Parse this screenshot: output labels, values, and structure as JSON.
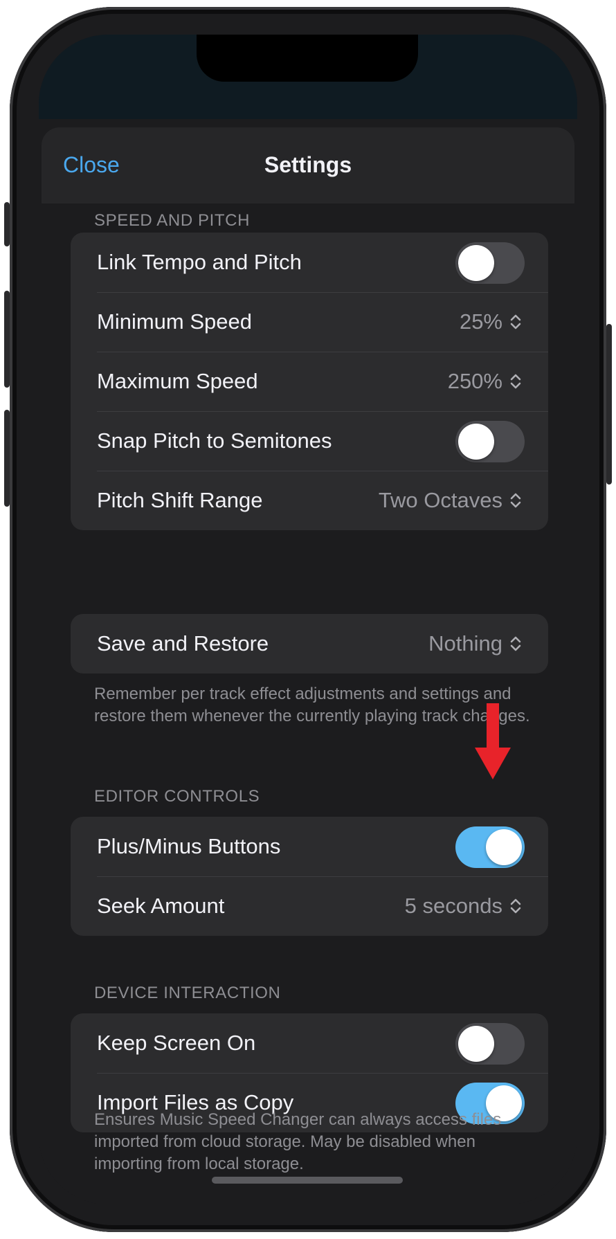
{
  "nav": {
    "close_label": "Close",
    "title": "Settings"
  },
  "sections": {
    "speed_pitch": {
      "header": "SPEED AND PITCH",
      "link_tempo": {
        "label": "Link Tempo and Pitch",
        "enabled": false
      },
      "min_speed": {
        "label": "Minimum Speed",
        "value": "25%"
      },
      "max_speed": {
        "label": "Maximum Speed",
        "value": "250%"
      },
      "snap_pitch": {
        "label": "Snap Pitch to Semitones",
        "enabled": false
      },
      "pitch_range": {
        "label": "Pitch Shift Range",
        "value": "Two Octaves"
      }
    },
    "save_restore": {
      "label": "Save and Restore",
      "value": "Nothing",
      "footnote": "Remember per track effect adjustments and settings and restore them whenever the currently playing track changes."
    },
    "editor_controls": {
      "header": "EDITOR CONTROLS",
      "plus_minus": {
        "label": "Plus/Minus Buttons",
        "enabled": true
      },
      "seek_amount": {
        "label": "Seek Amount",
        "value": "5 seconds"
      }
    },
    "device_interaction": {
      "header": "DEVICE INTERACTION",
      "keep_screen_on": {
        "label": "Keep Screen On",
        "enabled": false
      },
      "import_copy": {
        "label": "Import Files as Copy",
        "enabled": true
      },
      "footnote": "Ensures Music Speed Changer can always access files imported from cloud storage. May be disabled when importing from local storage."
    }
  },
  "colors": {
    "accent": "#4aa8ee",
    "toggle_on": "#5ab8f2",
    "annotation_arrow": "#e8232a"
  }
}
